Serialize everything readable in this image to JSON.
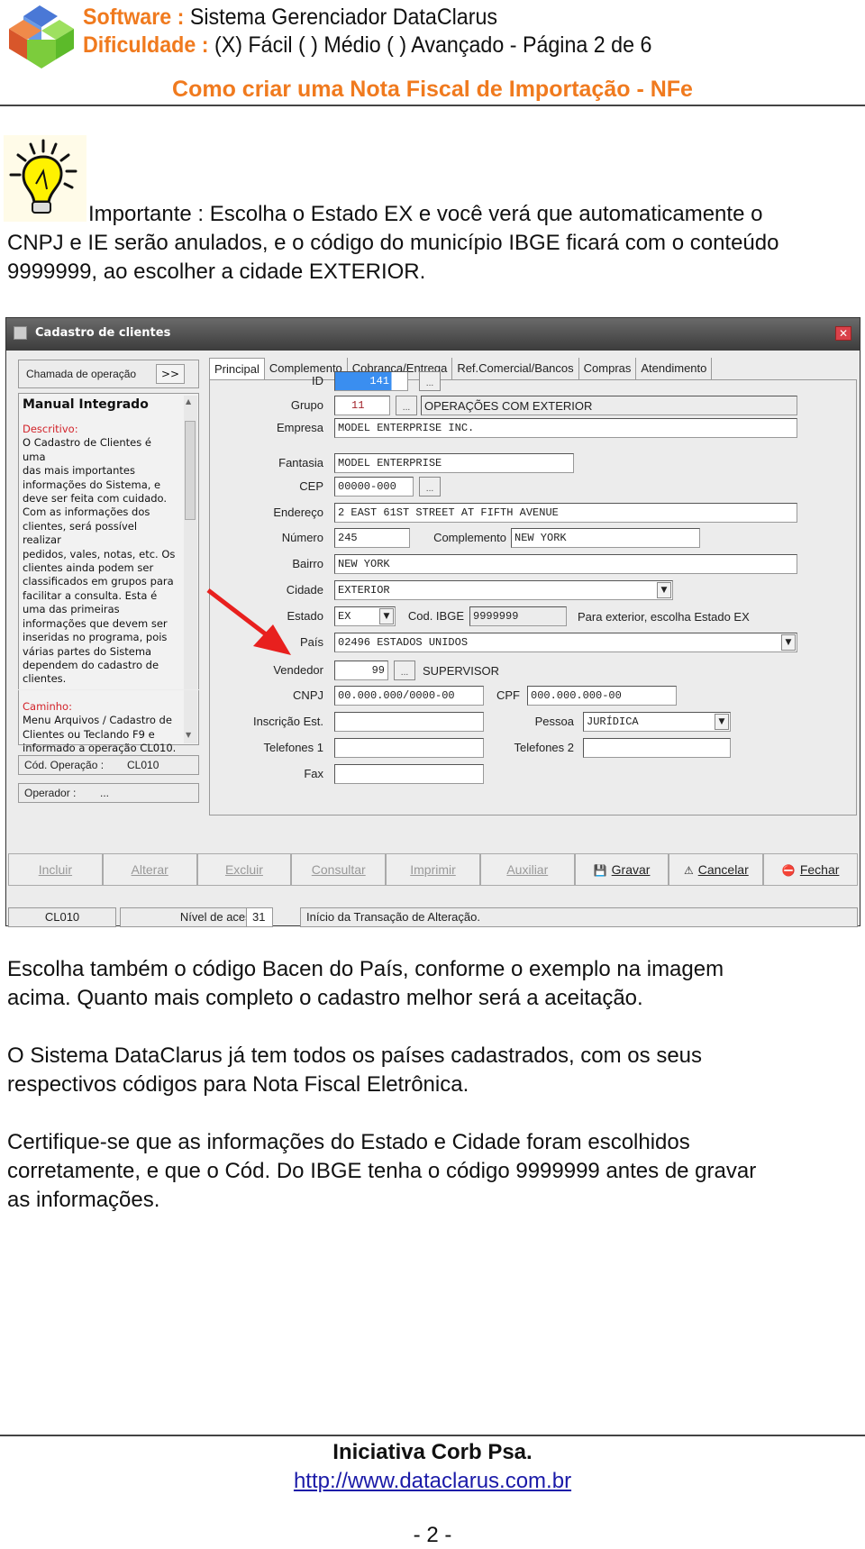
{
  "header": {
    "software_label": "Software :",
    "software_value": "Sistema Gerenciador DataClarus",
    "difficulty_label": "Dificuldade :",
    "difficulty_value": "(X) Fácil ( ) Médio ( ) Avançado - Página 2 de 6",
    "subtitle": "Como criar uma Nota Fiscal de Importação - NFe"
  },
  "tip": {
    "icon": "lightbulb-icon",
    "line1": "Importante : Escolha o Estado EX e você verá que automaticamente o",
    "line2": "CNPJ e IE serão anulados, e o código do município IBGE ficará com o conteúdo",
    "line3": "9999999, ao escolher a cidade EXTERIOR."
  },
  "window": {
    "title": "Cadastro de clientes",
    "close_icon": "close-icon",
    "chamada_label": "Chamada de operação",
    "chamada_button": ">>",
    "help": {
      "title": "Manual Integrado",
      "desc_label": "Descritivo:",
      "desc_lines": [
        "O Cadastro de Clientes é uma",
        "das mais importantes",
        "informações do Sistema, e",
        "deve ser feita com cuidado.",
        "Com as informações dos",
        "clientes, será possível realizar",
        "pedidos, vales, notas, etc. Os",
        "clientes ainda podem ser",
        "classificados em grupos para",
        "facilitar a consulta. Esta é",
        "uma das primeiras",
        "informações que devem ser",
        "inseridas no programa, pois",
        "várias partes do Sistema",
        "dependem do cadastro de",
        "clientes."
      ],
      "path_label": "Caminho:",
      "path_lines": [
        "Menu Arquivos / Cadastro de",
        "Clientes ou Teclando F9 e",
        "informado a operação CL010."
      ]
    },
    "cod_operacao_label": "Cód. Operação :",
    "cod_operacao_value": "CL010",
    "operador_label": "Operador :",
    "operador_value": "...",
    "tabs": [
      "Principal",
      "Complemento",
      "Cobrança/Entrega",
      "Ref.Comercial/Bancos",
      "Compras",
      "Atendimento"
    ],
    "form": {
      "id_label": "ID",
      "id_value": "141",
      "grupo_label": "Grupo",
      "grupo_value": "11",
      "grupo_desc": "OPERAÇÕES COM EXTERIOR",
      "empresa_label": "Empresa",
      "empresa_value": "MODEL ENTERPRISE INC.",
      "fantasia_label": "Fantasia",
      "fantasia_value": "MODEL ENTERPRISE",
      "cep_label": "CEP",
      "cep_value": "00000-000",
      "endereco_label": "Endereço",
      "endereco_value": "2 EAST 61ST STREET AT FIFTH AVENUE",
      "numero_label": "Número",
      "numero_value": "245",
      "complemento_label": "Complemento",
      "complemento_value": "NEW YORK",
      "bairro_label": "Bairro",
      "bairro_value": "NEW YORK",
      "cidade_label": "Cidade",
      "cidade_value": "EXTERIOR",
      "estado_label": "Estado",
      "estado_value": "EX",
      "ibge_label": "Cod. IBGE",
      "ibge_value": "9999999",
      "estado_hint": "Para exterior, escolha Estado EX",
      "pais_label": "País",
      "pais_value": "02496 ESTADOS UNIDOS",
      "vendedor_label": "Vendedor",
      "vendedor_value": "99",
      "vendedor_desc": "SUPERVISOR",
      "cnpj_label": "CNPJ",
      "cnpj_value": "00.000.000/0000-00",
      "cpf_label": "CPF",
      "cpf_value": "000.000.000-00",
      "ie_label": "Inscrição Est.",
      "ie_value": "",
      "pessoa_label": "Pessoa",
      "pessoa_value": "JURÍDICA",
      "tel1_label": "Telefones 1",
      "tel1_value": "",
      "tel2_label": "Telefones 2",
      "tel2_value": "",
      "fax_label": "Fax",
      "fax_value": "",
      "dots": "..."
    },
    "buttons": [
      {
        "label": "Incluir",
        "enabled": false
      },
      {
        "label": "Alterar",
        "enabled": false
      },
      {
        "label": "Excluir",
        "enabled": false
      },
      {
        "label": "Consultar",
        "enabled": false
      },
      {
        "label": "Imprimir",
        "enabled": false
      },
      {
        "label": "Auxiliar",
        "enabled": false
      },
      {
        "label": "Gravar",
        "enabled": true,
        "icon": "save-icon"
      },
      {
        "label": "Cancelar",
        "enabled": true,
        "icon": "cancel-icon"
      },
      {
        "label": "Fechar",
        "enabled": true,
        "icon": "exit-icon"
      }
    ],
    "statusbar": {
      "op": "CL010",
      "nivel_label": "Nível de acesso:",
      "nivel_value": "31",
      "message": "Início da Transação de Alteração."
    }
  },
  "paragraphs": [
    [
      "Escolha também o código Bacen do País, conforme o exemplo na imagem",
      "acima. Quanto mais completo o cadastro melhor será a aceitação."
    ],
    [
      "O Sistema DataClarus já tem todos os países cadastrados, com os seus",
      "respectivos códigos para Nota Fiscal Eletrônica."
    ],
    [
      "Certifique-se que as informações do Estado e Cidade foram escolhidos",
      "corretamente, e que o Cód. Do IBGE tenha o código 9999999 antes de gravar",
      "as informações."
    ]
  ],
  "footer": {
    "title": "Iniciativa Corb Psa.",
    "link": "http://www.dataclarus.com.br",
    "page": "- 2 -"
  },
  "colors": {
    "accent_orange": "#f07a1e",
    "help_red": "#d2232a",
    "arrow_red": "#e8201e",
    "link_blue": "#1a1aa8"
  }
}
